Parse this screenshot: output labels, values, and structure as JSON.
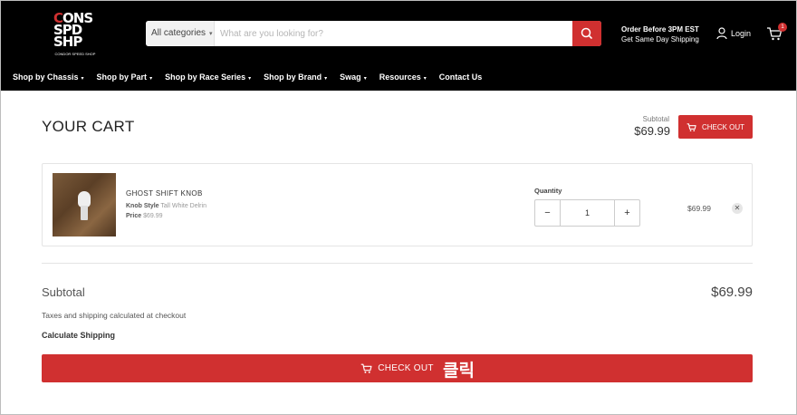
{
  "header": {
    "logo": {
      "line1": "CONS",
      "line2": "SPD",
      "line3": "SHP",
      "tagline": "CONDOR SPEED SHOP"
    },
    "search": {
      "category": "All categories",
      "placeholder": "What are you looking for?"
    },
    "shipping_promo": {
      "line1": "Order Before 3PM EST",
      "line2": "Get Same Day Shipping"
    },
    "login_label": "Login",
    "cart_count": "1"
  },
  "nav": {
    "items": [
      {
        "label": "Shop by Chassis",
        "has_dropdown": true
      },
      {
        "label": "Shop by Part",
        "has_dropdown": true
      },
      {
        "label": "Shop by Race Series",
        "has_dropdown": true
      },
      {
        "label": "Shop by Brand",
        "has_dropdown": true
      },
      {
        "label": "Swag",
        "has_dropdown": true
      },
      {
        "label": "Resources",
        "has_dropdown": true
      },
      {
        "label": "Contact Us",
        "has_dropdown": false
      }
    ]
  },
  "cart": {
    "title": "YOUR CART",
    "top_subtotal_label": "Subtotal",
    "top_subtotal_value": "$69.99",
    "checkout_label": "CHECK OUT",
    "item": {
      "name": "GHOST SHIFT KNOB",
      "style_key": "Knob Style",
      "style_value": "Tall White Delrin",
      "price_key": "Price",
      "price_value": "$69.99",
      "quantity_label": "Quantity",
      "quantity": "1",
      "line_total": "$69.99"
    },
    "subtotal_label": "Subtotal",
    "subtotal_value": "$69.99",
    "tax_note": "Taxes and shipping calculated at checkout",
    "calculate_shipping": "Calculate Shipping",
    "click_annotation": "클릭"
  },
  "colors": {
    "accent": "#d03030",
    "header_bg": "#000000"
  }
}
